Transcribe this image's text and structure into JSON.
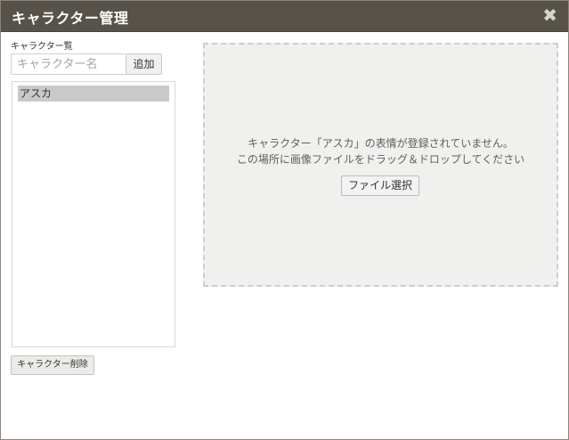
{
  "dialog": {
    "title": "キャラクター管理",
    "close_glyph": "✖"
  },
  "sidebar": {
    "list_label": "キャラクター覧",
    "name_input": {
      "value": "",
      "placeholder": "キャラクター名"
    },
    "add_label": "追加",
    "characters": [
      {
        "name": "アスカ",
        "selected": true
      }
    ],
    "delete_label": "キャラクター削除"
  },
  "dropzone": {
    "message_line1": "キャラクター「アスカ」の表情が登録されていません。",
    "message_line2": "この場所に画像ファイルをドラッグ＆ドロップしてください",
    "file_button_label": "ファイル選択"
  },
  "colors": {
    "titlebar": "#57534a",
    "selected_item": "#c9c9c9",
    "dropzone_bg": "#f0f0ee"
  }
}
